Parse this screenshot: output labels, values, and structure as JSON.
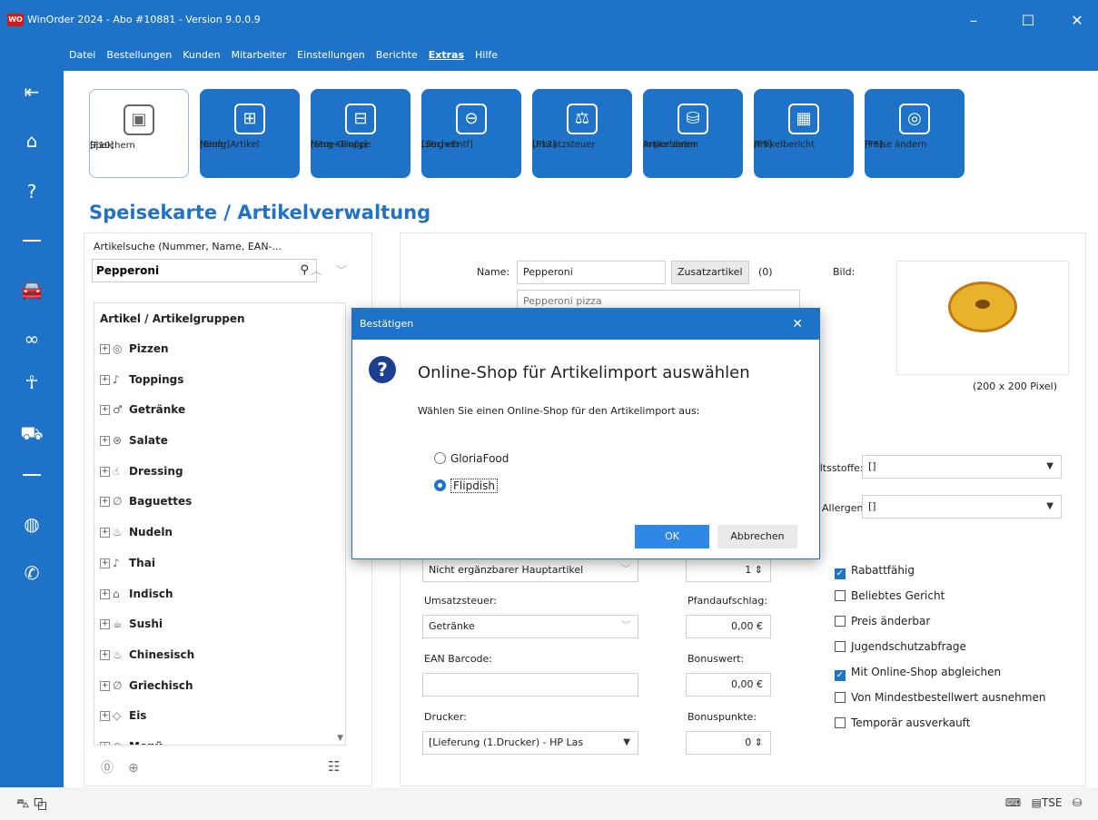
{
  "window": {
    "logo": "WO",
    "title": "WinOrder 2024 - Abo #10881 - Version 9.0.0.9",
    "controls": [
      "–",
      "☐",
      "✕"
    ]
  },
  "menu": {
    "items": [
      "Datei",
      "Bestellungen",
      "Kunden",
      "Mitarbeiter",
      "Einstellungen",
      "Berichte",
      "Extras",
      "Hilfe"
    ],
    "active": "Extras"
  },
  "toolbar": {
    "buttons": [
      {
        "label1": "Speichern",
        "label2": "[F10]",
        "icon": "save-icon"
      },
      {
        "label1": "Neuer Artikel",
        "label2": "[Einfg]",
        "icon": "new-article-icon"
      },
      {
        "label1": "Neue Gruppe",
        "label2": "[Strg+Einfg]",
        "icon": "new-group-icon"
      },
      {
        "label1": "Löschen",
        "label2": "[Strg+Entf]",
        "icon": "delete-icon"
      },
      {
        "label1": "Umsatzsteuer",
        "label2": "[F12]",
        "icon": "tax-icon"
      },
      {
        "label1": "Artikeldaten",
        "label2": "importieren",
        "icon": "import-icon"
      },
      {
        "label1": "Artikelbericht",
        "label2": "[F9]",
        "icon": "report-icon"
      },
      {
        "label1": "Preise ändern",
        "label2": "[F6]",
        "icon": "prices-icon"
      }
    ]
  },
  "page": {
    "title": "Speisekarte / Artikelverwaltung"
  },
  "search": {
    "label": "Artikelsuche (Nummer, Name, EAN-...",
    "value": "Pepperoni"
  },
  "tree": {
    "header": "Artikel / Artikelgruppen",
    "items": [
      "Pizzen",
      "Toppings",
      "Getränke",
      "Salate",
      "Dressing",
      "Baguettes",
      "Nudeln",
      "Thai",
      "Indisch",
      "Sushi",
      "Chinesisch",
      "Griechisch",
      "Eis",
      "Menü"
    ]
  },
  "article": {
    "name_label": "Name:",
    "name_value": "Pepperoni",
    "desc_value": "Pepperoni pizza",
    "zusatz_label": "Zusatzartikel",
    "zusatz_count": "(0)",
    "image_label": "Bild:",
    "image_size": "(200 x 200 Pixel)",
    "inhaltsstoffe_label": "haltsstoffe:",
    "inhaltsstoffe_value": "[]",
    "allergene_label": "Allergene:",
    "allergene_value": "[]",
    "type_value": "Nicht ergänzbarer Hauptartikel",
    "qty_value": "1",
    "umsatzsteuer_label": "Umsatzsteuer:",
    "umsatzsteuer_value": "Getränke",
    "pfand_label": "Pfandaufschlag:",
    "pfand_value": "0,00 €",
    "ean_label": "EAN Barcode:",
    "ean_value": "",
    "bonuswert_label": "Bonuswert:",
    "bonuswert_value": "0,00 €",
    "drucker_label": "Drucker:",
    "drucker_value": "[Lieferung (1.Drucker) - HP Las",
    "bonuspunkte_label": "Bonuspunkte:",
    "bonuspunkte_value": "0"
  },
  "checkboxes": [
    {
      "label": "Rabattfähig",
      "checked": true
    },
    {
      "label": "Beliebtes Gericht",
      "checked": false
    },
    {
      "label": "Preis änderbar",
      "checked": false
    },
    {
      "label": "Jugendschutzabfrage",
      "checked": false
    },
    {
      "label": "Mit Online-Shop abgleichen",
      "checked": true
    },
    {
      "label": "Von Mindestbestellwert ausnehmen",
      "checked": false
    },
    {
      "label": "Temporär ausverkauft",
      "checked": false
    }
  ],
  "dialog": {
    "title": "Bestätigen",
    "heading": "Online-Shop für Artikelimport auswählen",
    "message": "Wählen Sie einen Online-Shop für den Artikelimport aus:",
    "options": [
      {
        "label": "GloriaFood",
        "selected": false
      },
      {
        "label": "Flipdish",
        "selected": true
      }
    ],
    "ok_label": "OK",
    "cancel_label": "Abbrechen"
  },
  "statusbar": {
    "tse_label": "TSE"
  }
}
